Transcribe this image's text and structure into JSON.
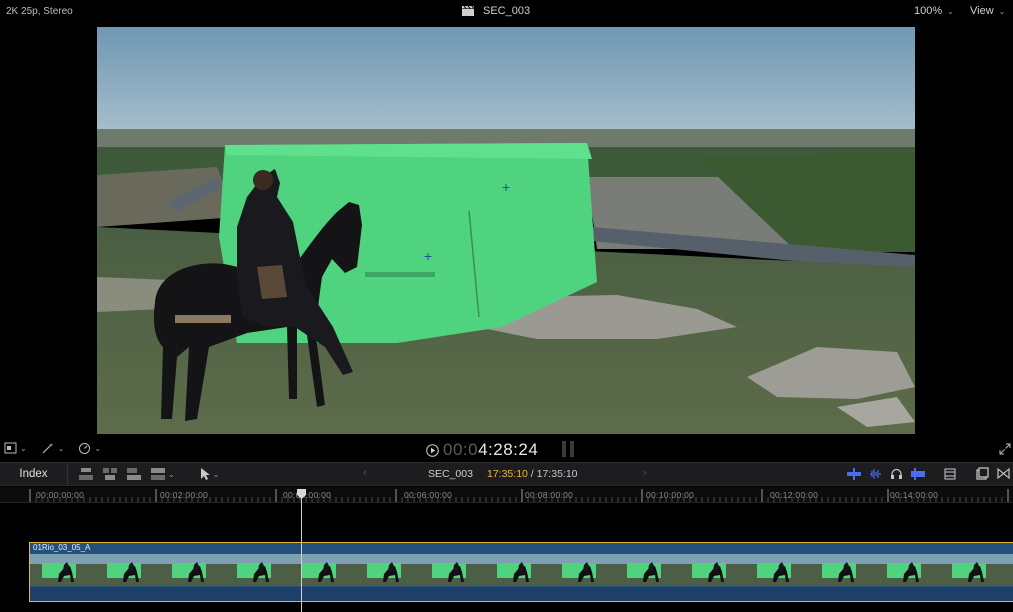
{
  "viewer": {
    "format_info": "2K 25p, Stereo",
    "clip_title": "SEC_003",
    "zoom_label": "100%",
    "view_label": "View",
    "timecode_dim": "00:0",
    "timecode_bright": "4:28:24"
  },
  "toolbar": {
    "index_label": "Index",
    "project_name": "SEC_003",
    "current_duration": "17:35:10",
    "total_duration": "/ 17:35:10"
  },
  "ruler": {
    "labels": [
      "00:00:00:00",
      "00:02:00:00",
      "00:04:00:00",
      "00:06:00:00",
      "00:08:00:00",
      "00:10:00:00",
      "00:12:00:00",
      "00:14:00:00"
    ]
  },
  "clip": {
    "name": "01Rio_03_05_A",
    "selected_color": "#e4b640",
    "video_color": "#24507c"
  },
  "colors": {
    "accent_duration": "#f0b437",
    "audio_tools": "#4a6cf0"
  },
  "icons": [
    "clapperboard-icon",
    "chevron-down-icon",
    "play-icon",
    "pause-icon",
    "fullscreen-icon",
    "select-tool-icon",
    "audio-skimming-icon",
    "headphones-icon",
    "snapping-icon"
  ]
}
